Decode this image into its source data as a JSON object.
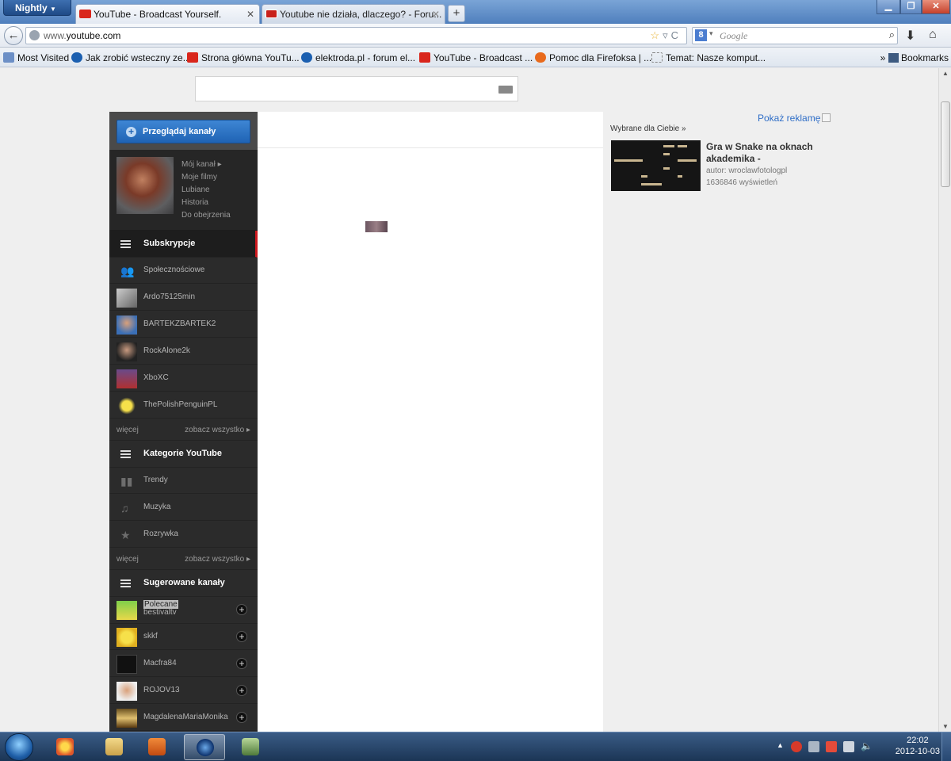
{
  "browser": {
    "app_button": "Nightly",
    "tabs": [
      {
        "label": "YouTube - Broadcast Yourself.",
        "active": true
      },
      {
        "label": "Youtube nie działa, dlaczego? - Foru...",
        "active": false
      }
    ],
    "url_host_prefix": "www.",
    "url_host": "youtube.com",
    "search_placeholder": "Google",
    "search_engine_letter": "8"
  },
  "bookmarks": {
    "items": [
      "Most Visited",
      "Jak zrobić wsteczny ze...",
      "Strona główna YouTu...",
      "elektroda.pl - forum el...",
      "YouTube - Broadcast ...",
      "Pomoc dla Firefoksa | ...",
      "Temat: Nasze komput..."
    ],
    "overflow_label": "»",
    "bookmarks_label": "Bookmarks"
  },
  "guide": {
    "browse_button": "Przeglądaj kanały",
    "profile_links": [
      "Mój kanał ▸",
      "Moje filmy",
      "Lubiane",
      "Historia",
      "Do obejrzenia"
    ],
    "subscriptions_header": "Subskrypcje",
    "subscriptions": [
      "Społecznościowe",
      "Ardo75125min",
      "BARTEKZBARTEK2",
      "RockAlone2k",
      "XboXC",
      "ThePolishPenguinPL"
    ],
    "more_label": "więcej",
    "see_all_label": "zobacz wszystko ▸",
    "categories_header": "Kategorie YouTube",
    "categories": [
      "Trendy",
      "Muzyka",
      "Rozrywka"
    ],
    "suggested_header": "Sugerowane kanały",
    "suggested": [
      {
        "badge": "Polecane",
        "name": "bestivaltv"
      },
      {
        "badge": "",
        "name": "skkf"
      },
      {
        "badge": "",
        "name": "Macfra84"
      },
      {
        "badge": "",
        "name": "ROJOV13"
      },
      {
        "badge": "",
        "name": "MagdalenaMariaMonika"
      }
    ],
    "add_symbol": "+"
  },
  "sidebar": {
    "show_ads": "Pokaż reklamę",
    "featured_label": "Wybrane dla Ciebie »",
    "video_title": "Gra w Snake na oknach akademika -",
    "video_author": "autor: wroclawfotologpl",
    "video_views": "1636846 wyświetleń"
  },
  "taskbar": {
    "time": "22:02",
    "date": "2012-10-03"
  }
}
